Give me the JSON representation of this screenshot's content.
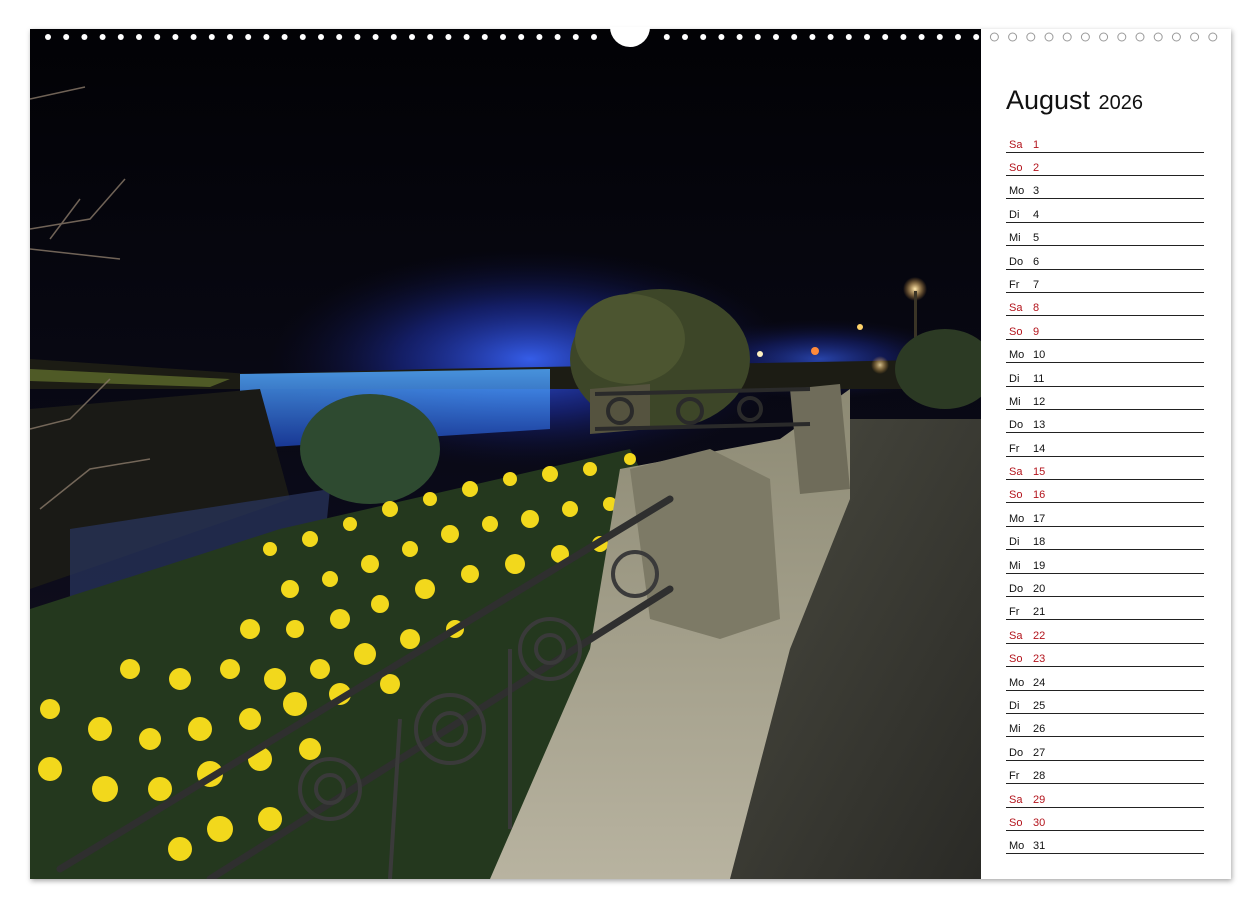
{
  "calendar": {
    "month": "August",
    "year": "2026",
    "days": [
      {
        "abbr": "Sa",
        "num": "1",
        "weekend": true
      },
      {
        "abbr": "So",
        "num": "2",
        "weekend": true
      },
      {
        "abbr": "Mo",
        "num": "3",
        "weekend": false
      },
      {
        "abbr": "Di",
        "num": "4",
        "weekend": false
      },
      {
        "abbr": "Mi",
        "num": "5",
        "weekend": false
      },
      {
        "abbr": "Do",
        "num": "6",
        "weekend": false
      },
      {
        "abbr": "Fr",
        "num": "7",
        "weekend": false
      },
      {
        "abbr": "Sa",
        "num": "8",
        "weekend": true
      },
      {
        "abbr": "So",
        "num": "9",
        "weekend": true
      },
      {
        "abbr": "Mo",
        "num": "10",
        "weekend": false
      },
      {
        "abbr": "Di",
        "num": "11",
        "weekend": false
      },
      {
        "abbr": "Mi",
        "num": "12",
        "weekend": false
      },
      {
        "abbr": "Do",
        "num": "13",
        "weekend": false
      },
      {
        "abbr": "Fr",
        "num": "14",
        "weekend": false
      },
      {
        "abbr": "Sa",
        "num": "15",
        "weekend": true
      },
      {
        "abbr": "So",
        "num": "16",
        "weekend": true
      },
      {
        "abbr": "Mo",
        "num": "17",
        "weekend": false
      },
      {
        "abbr": "Di",
        "num": "18",
        "weekend": false
      },
      {
        "abbr": "Mi",
        "num": "19",
        "weekend": false
      },
      {
        "abbr": "Do",
        "num": "20",
        "weekend": false
      },
      {
        "abbr": "Fr",
        "num": "21",
        "weekend": false
      },
      {
        "abbr": "Sa",
        "num": "22",
        "weekend": true
      },
      {
        "abbr": "So",
        "num": "23",
        "weekend": true
      },
      {
        "abbr": "Mo",
        "num": "24",
        "weekend": false
      },
      {
        "abbr": "Di",
        "num": "25",
        "weekend": false
      },
      {
        "abbr": "Mi",
        "num": "26",
        "weekend": false
      },
      {
        "abbr": "Do",
        "num": "27",
        "weekend": false
      },
      {
        "abbr": "Fr",
        "num": "28",
        "weekend": false
      },
      {
        "abbr": "Sa",
        "num": "29",
        "weekend": true
      },
      {
        "abbr": "So",
        "num": "30",
        "weekend": true
      },
      {
        "abbr": "Mo",
        "num": "31",
        "weekend": false
      }
    ]
  },
  "colors": {
    "weekend_text": "#b3141c",
    "weekday_text": "#111111",
    "falls_glow": "#2f5cff",
    "daffodil": "#f2d81c"
  },
  "photo": {
    "icon": "night-waterfall-photo"
  }
}
